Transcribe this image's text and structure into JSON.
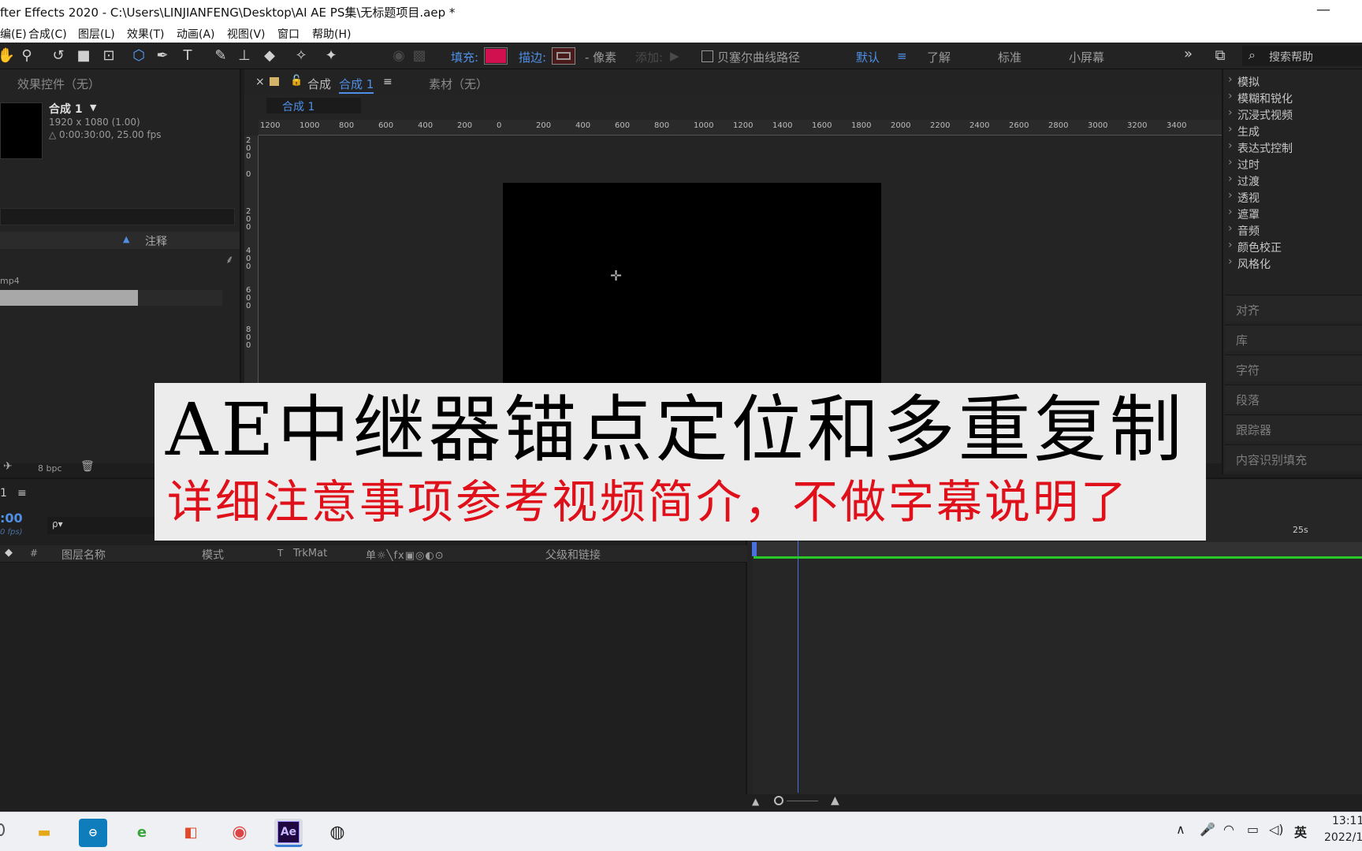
{
  "window": {
    "title": "fter Effects 2020 - C:\\Users\\LINJIANFENG\\Desktop\\AI AE PS集\\无标题项目.aep *",
    "minimize": "—"
  },
  "menu": [
    "编(E)",
    "合成(C)",
    "图层(L)",
    "效果(T)",
    "动画(A)",
    "视图(V)",
    "窗口",
    "帮助(H)"
  ],
  "toolbar": {
    "fill_label": "填充:",
    "stroke_label": "描边:",
    "stroke_unit": "- 像素",
    "add_label": "添加:",
    "bezier_label": "贝塞尔曲线路径",
    "workspace_default": "默认",
    "workspace_menu": "≡",
    "workspace_learn": "了解",
    "workspace_standard": "标准",
    "workspace_small": "小屏幕",
    "more": "»",
    "search_placeholder": "搜索帮助",
    "fill_color": "#d1114f",
    "stroke_color": "#4a1a1a"
  },
  "left_panel": {
    "title": "效果控件（无）",
    "comp_name": "合成 1",
    "comp_size": "1920 x 1080 (1.00)",
    "comp_duration": "△ 0:00:30:00, 25.00 fps",
    "column_comments": "注释",
    "file_item": "mp4",
    "footer_bpc": "8 bpc",
    "progress": 0.62
  },
  "comp_panel": {
    "tab_close": "×",
    "tab_label_prefix": "合成",
    "tab_label": "合成 1",
    "tab_menu": "≡",
    "footage_tab": "素材（无）",
    "sub_tab": "合成 1",
    "ruler_h": [
      "1200",
      "1000",
      "800",
      "600",
      "400",
      "200",
      "0",
      "200",
      "400",
      "600",
      "800",
      "1000",
      "1200",
      "1400",
      "1600",
      "1800",
      "2000",
      "2200",
      "2400",
      "2600",
      "2800",
      "3000",
      "3200",
      "3400"
    ],
    "ruler_v": [
      "2 0 0",
      "0",
      "2 0 0",
      "4 0 0",
      "6 0 0",
      "8 0 0"
    ]
  },
  "effects_panel": {
    "items": [
      "模拟",
      "模糊和锐化",
      "沉浸式视频",
      "生成",
      "表达式控制",
      "过时",
      "过渡",
      "透视",
      "遮罩",
      "音频",
      "颜色校正",
      "风格化"
    ],
    "sections": [
      "对齐",
      "库",
      "字符",
      "段落",
      "跟踪器",
      "内容识别填充"
    ]
  },
  "timeline": {
    "tab": "1",
    "tab_menu": "≡",
    "timecode": ":00",
    "fps": "0 fps)",
    "search_icon_label": "ρ▾",
    "columns": {
      "hash": "#",
      "layer_name": "图层名称",
      "mode": "模式",
      "t": "T",
      "trkmat": "TrkMat",
      "switches": "单☼╲fx▣◎◐⊙",
      "parent": "父级和链接"
    },
    "time_marker": "25s"
  },
  "taskbar": {
    "ae_label": "Ae",
    "ime": "英",
    "time": "13:11",
    "date": "2022/1"
  },
  "overlay": {
    "headline": "AE中继器锚点定位和多重复制",
    "subline": "详细注意事项参考视频简介，不做字幕说明了"
  }
}
